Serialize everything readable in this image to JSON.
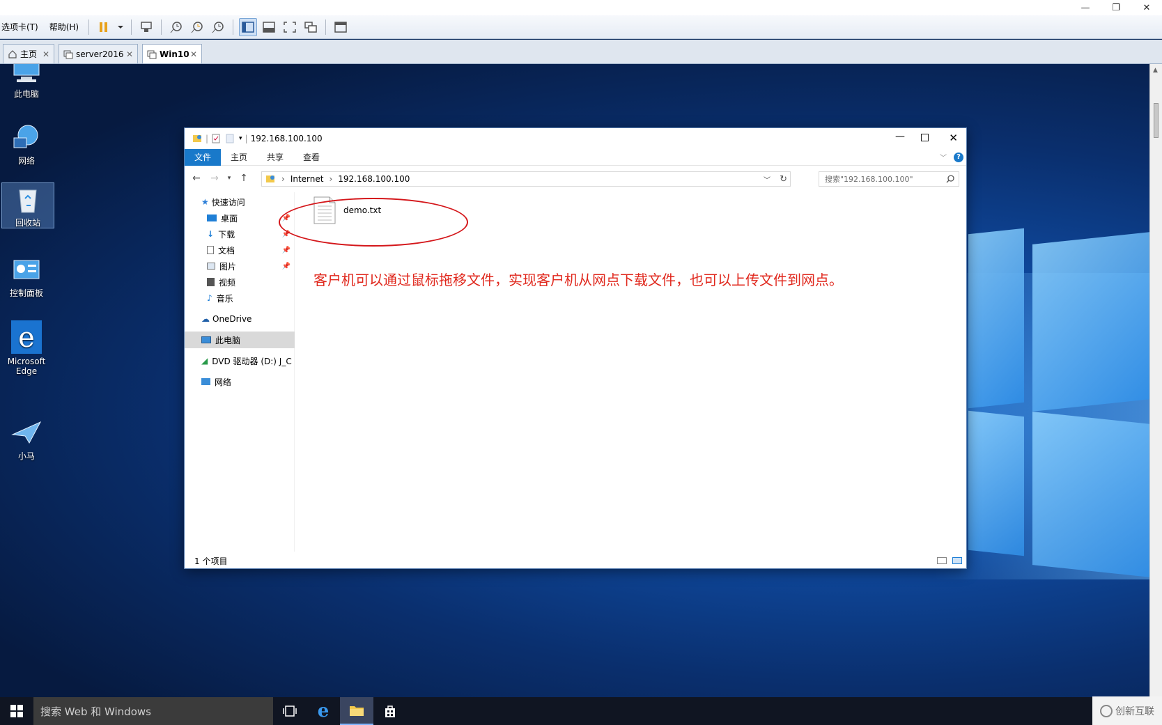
{
  "host": {
    "menus": [
      "选项卡(T)",
      "帮助(H)"
    ],
    "tabs": [
      {
        "label": "主页"
      },
      {
        "label": "server2016"
      },
      {
        "label": "Win10"
      }
    ],
    "tab_close": "✕",
    "window_controls": {
      "minimize": "—",
      "restore": "❐",
      "close": "✕"
    }
  },
  "desktop": {
    "icons": [
      {
        "label": "此电脑"
      },
      {
        "label": "网络"
      },
      {
        "label": "回收站"
      },
      {
        "label": "控制面板"
      },
      {
        "label": "Microsoft Edge"
      },
      {
        "label": "小马"
      }
    ]
  },
  "explorer": {
    "title": "192.168.100.100",
    "ribbon_tabs": [
      "文件",
      "主页",
      "共享",
      "查看"
    ],
    "address": {
      "segment1": "Internet",
      "segment2": "192.168.100.100"
    },
    "search_placeholder": "搜索\"192.168.100.100\"",
    "nav": {
      "quick_access": "快速访问",
      "items": [
        "桌面",
        "下载",
        "文档",
        "图片",
        "视频",
        "音乐"
      ],
      "onedrive": "OneDrive",
      "this_pc": "此电脑",
      "dvd": "DVD 驱动器 (D:) J_C",
      "network": "网络"
    },
    "files": [
      {
        "name": "demo.txt"
      }
    ],
    "status": "1 个项目"
  },
  "annotation": "客户机可以通过鼠标拖移文件，实现客户机从网点下载文件，也可以上传文件到网点。",
  "taskbar": {
    "search": "搜索 Web 和 Windows"
  },
  "watermark": "创新互联"
}
